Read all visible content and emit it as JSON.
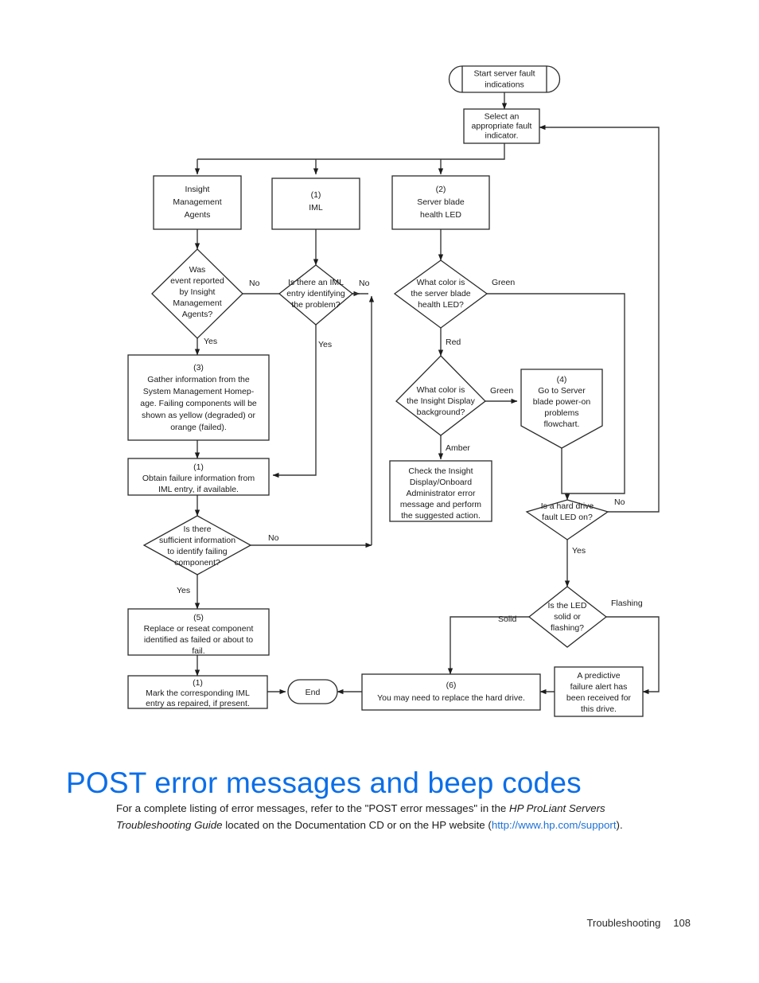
{
  "page": {
    "footer_section": "Troubleshooting",
    "footer_page_number": "108",
    "accent_color": "#0b6ee8",
    "link_color": "#1d72d6"
  },
  "heading": "POST error messages and beep codes",
  "paragraph": {
    "part1": "For a complete listing of error messages, refer to the \"POST error messages\" in the ",
    "italic1": "HP ProLiant Servers Troubleshooting Guide",
    "part2": " located on the Documentation CD or on the HP website (",
    "link": "http://www.hp.com/support",
    "part3": ")."
  },
  "flowchart": {
    "title": "Server fault indications flowchart",
    "nodes": {
      "start": "Start server fault indications",
      "select_indicator": "Select an appropriate fault indicator.",
      "insight_agents": "Insight Management Agents",
      "iml": "(1)\nIML",
      "iml_ref": "(1)",
      "iml_label": "IML",
      "blade_health_led_ref": "(2)",
      "blade_health_led": "Server blade health LED",
      "q_event_reported": "Was event reported by Insight Management Agents?",
      "q_iml_entry": "Is there an IML entry identifying the problem?",
      "q_led_color": "What color is the server blade health LED?",
      "gather_info_ref": "(3)",
      "gather_info": "Gather information from the System Management Homepage. Failing components will be shown as yellow (degraded) or orange (failed).",
      "obtain_failure_ref": "(1)",
      "obtain_failure": "Obtain failure information from IML entry, if available.",
      "q_insight_display_bg": "What color is the Insight Display background?",
      "goto_poweron_ref": "(4)",
      "goto_poweron": "Go to Server blade power-on problems flowchart.",
      "check_insight_display": "Check the Insight Display/Onboard Administrator error message and perform the suggested action.",
      "q_sufficient_info": "Is there sufficient information to identify failing component?",
      "q_hdd_fault_led": "Is a hard drive fault LED on?",
      "q_led_solid_flashing": "Is the LED solid or flashing?",
      "replace_component_ref": "(5)",
      "replace_component": "Replace or reseat component identified as failed or about to fail.",
      "mark_iml_ref": "(1)",
      "mark_iml": "Mark the corresponding IML entry as repaired, if present.",
      "predictive_alert": "A predictive failure alert has been received for this drive.",
      "replace_hdd_ref": "(6)",
      "replace_hdd": "You may need to replace the hard drive.",
      "end": "End"
    },
    "edge_labels": {
      "no_event_reported": "No",
      "yes_event_reported": "Yes",
      "no_iml_entry": "No",
      "yes_iml_entry": "Yes",
      "green_led": "Green",
      "red_led": "Red",
      "green_display": "Green",
      "amber_display": "Amber",
      "no_sufficient": "No",
      "yes_sufficient": "Yes",
      "no_hdd": "No",
      "yes_hdd": "Yes",
      "solid_led": "Solid",
      "flashing_led": "Flashing"
    },
    "node_text_lines": {
      "start": [
        "Start server fault",
        "indications"
      ],
      "select_indicator": [
        "Select an",
        "appropriate fault",
        "indicator."
      ],
      "insight_agents": [
        "Insight",
        "Management",
        "Agents"
      ],
      "iml": [
        "(1)",
        "IML"
      ],
      "blade_health_led": [
        "(2)",
        "Server blade",
        "health LED"
      ],
      "q_event_reported": [
        "Was",
        "event reported",
        "by Insight",
        "Management",
        "Agents?"
      ],
      "q_iml_entry": [
        "Is there an IML",
        "entry identifying",
        "the problem?"
      ],
      "q_led_color": [
        "What color is",
        "the server blade",
        "health LED?"
      ],
      "gather_info": [
        "(3)",
        "Gather information from the",
        "System Management Homep-",
        "age. Failing components will be",
        "shown as yellow (degraded) or",
        "orange (failed)."
      ],
      "obtain_failure": [
        "(1)",
        "Obtain failure information from",
        "IML entry, if available."
      ],
      "q_insight_display_bg": [
        "What color is",
        "the Insight Display",
        "background?"
      ],
      "goto_poweron": [
        "(4)",
        "Go to Server",
        "blade power-on",
        "problems",
        "flowchart."
      ],
      "check_insight_display": [
        "Check the Insight",
        "Display/Onboard",
        "Administrator error",
        "message and perform",
        "the suggested action."
      ],
      "q_sufficient_info": [
        "Is there",
        "sufficient information",
        "to identify failing",
        "component?"
      ],
      "q_hdd_fault_led": [
        "Is a hard drive",
        "fault LED on?"
      ],
      "q_led_solid_flashing": [
        "Is the LED",
        "solid or",
        "flashing?"
      ],
      "replace_component": [
        "(5)",
        "Replace or reseat component",
        "identified as failed or about to",
        "fail."
      ],
      "mark_iml": [
        "(1)",
        "Mark the corresponding IML",
        "entry as repaired, if present."
      ],
      "predictive_alert": [
        "A predictive",
        "failure alert has",
        "been received for",
        "this drive."
      ],
      "replace_hdd": [
        "(6)",
        "You may need to replace the hard drive."
      ],
      "end": [
        "End"
      ]
    }
  }
}
